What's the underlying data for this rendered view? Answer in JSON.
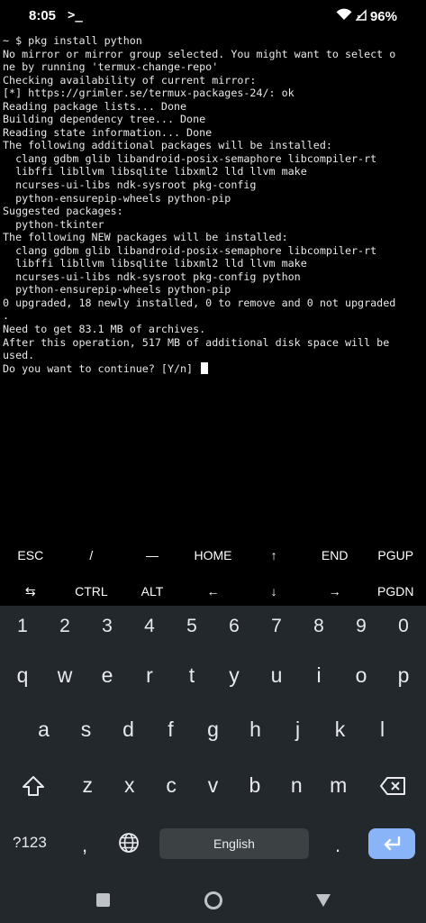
{
  "status_bar": {
    "time": "8:05",
    "terminal_glyph": ">_",
    "battery_percent": "96%",
    "icons": [
      "wifi-icon",
      "signal-icon",
      "battery-text"
    ]
  },
  "terminal": {
    "lines": [
      "~ $ pkg install python",
      "No mirror or mirror group selected. You might want to select o",
      "ne by running 'termux-change-repo'",
      "Checking availability of current mirror:",
      "[*] https://grimler.se/termux-packages-24/: ok",
      "Reading package lists... Done",
      "Building dependency tree... Done",
      "Reading state information... Done",
      "The following additional packages will be installed:",
      "  clang gdbm glib libandroid-posix-semaphore libcompiler-rt",
      "  libffi libllvm libsqlite libxml2 lld llvm make",
      "  ncurses-ui-libs ndk-sysroot pkg-config",
      "  python-ensurepip-wheels python-pip",
      "Suggested packages:",
      "  python-tkinter",
      "The following NEW packages will be installed:",
      "  clang gdbm glib libandroid-posix-semaphore libcompiler-rt",
      "  libffi libllvm libsqlite libxml2 lld llvm make",
      "  ncurses-ui-libs ndk-sysroot pkg-config python",
      "  python-ensurepip-wheels python-pip",
      "0 upgraded, 18 newly installed, 0 to remove and 0 not upgraded",
      ".",
      "Need to get 83.1 MB of archives.",
      "After this operation, 517 MB of additional disk space will be",
      "used.",
      "Do you want to continue? [Y/n] "
    ]
  },
  "extra_keys": {
    "row1": [
      "ESC",
      "/",
      "—",
      "HOME",
      "↑",
      "END",
      "PGUP"
    ],
    "row2": [
      "⇆",
      "CTRL",
      "ALT",
      "←",
      "↓",
      "→",
      "PGDN"
    ]
  },
  "keyboard": {
    "numbers": [
      "1",
      "2",
      "3",
      "4",
      "5",
      "6",
      "7",
      "8",
      "9",
      "0"
    ],
    "row1": [
      "q",
      "w",
      "e",
      "r",
      "t",
      "y",
      "u",
      "i",
      "o",
      "p"
    ],
    "row2": [
      "a",
      "s",
      "d",
      "f",
      "g",
      "h",
      "j",
      "k",
      "l"
    ],
    "row3": [
      "z",
      "x",
      "c",
      "v",
      "b",
      "n",
      "m"
    ],
    "symbols_label": "?123",
    "comma": ",",
    "period": ".",
    "space_label": "English"
  },
  "colors": {
    "terminal_bg": "#000000",
    "keyboard_bg": "#23282d",
    "enter_key": "#8ab4f8",
    "space_key": "#3c4144"
  }
}
